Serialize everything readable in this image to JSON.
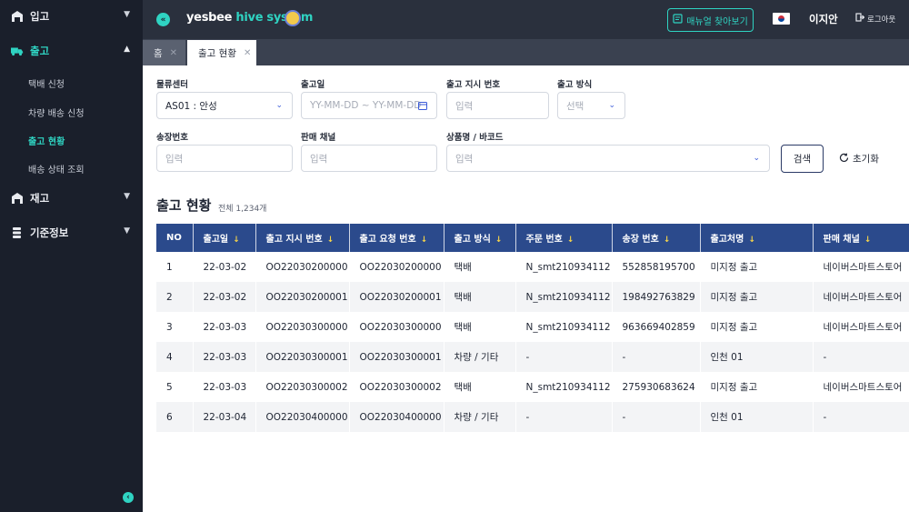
{
  "app": {
    "brand_part1": "yesbee",
    "brand_part2": "hive system",
    "accent_color": "#2fd3c2",
    "header_color": "#2b4a8c"
  },
  "sidebar": {
    "groups": [
      {
        "label": "입고",
        "icon": "warehouse-icon",
        "expanded": false
      },
      {
        "label": "출고",
        "icon": "truck-icon",
        "expanded": true
      },
      {
        "label": "재고",
        "icon": "warehouse-icon",
        "expanded": false
      },
      {
        "label": "기준정보",
        "icon": "database-icon",
        "expanded": false
      }
    ],
    "sub_items": [
      {
        "label": "택배 신청"
      },
      {
        "label": "차량 배송 신청"
      },
      {
        "label": "출고 현황"
      },
      {
        "label": "배송 상태 조회"
      }
    ]
  },
  "topbar": {
    "manual_button": "매뉴얼 찾아보기",
    "user_name": "이지안",
    "logout": "로그아웃",
    "flag": "korea-flag-icon"
  },
  "tabs": [
    {
      "label": "홈"
    },
    {
      "label": "출고 현황"
    }
  ],
  "filters": {
    "center_label": "물류센터",
    "center_value": "AS01 : 안성",
    "date_label": "출고일",
    "date_placeholder": "YY-MM-DD ~ YY-MM-DD",
    "instruction_label": "출고 지시 번호",
    "instruction_placeholder": "입력",
    "method_label": "출고 방식",
    "method_placeholder": "선택",
    "invoice_label": "송장번호",
    "invoice_placeholder": "입력",
    "channel_label": "판매 채널",
    "channel_placeholder": "입력",
    "product_label": "상품명 / 바코드",
    "product_placeholder": "입력",
    "search_button": "검색",
    "reset_button": "초기화"
  },
  "section": {
    "title": "출고 현황",
    "count": "전체 1,234개"
  },
  "table": {
    "columns": [
      "NO",
      "출고일",
      "출고 지시 번호",
      "출고 요청 번호",
      "출고 방식",
      "주문 번호",
      "송장 번호",
      "출고처명",
      "판매 채널"
    ],
    "sortable": [
      false,
      true,
      true,
      true,
      true,
      true,
      true,
      true,
      true
    ],
    "sort_arrow": "↓",
    "rows": [
      [
        "1",
        "22-03-02",
        "OO22030200000",
        "OO22030200000",
        "택배",
        "N_smt210934112",
        "552858195700",
        "미지정 출고",
        "네이버스마트스토어"
      ],
      [
        "2",
        "22-03-02",
        "OO22030200001",
        "OO22030200001",
        "택배",
        "N_smt210934112",
        "198492763829",
        "미지정 출고",
        "네이버스마트스토어"
      ],
      [
        "3",
        "22-03-03",
        "OO22030300000",
        "OO22030300000",
        "택배",
        "N_smt210934112",
        "963669402859",
        "미지정 출고",
        "네이버스마트스토어"
      ],
      [
        "4",
        "22-03-03",
        "OO22030300001",
        "OO22030300001",
        "차량 / 기타",
        "-",
        "-",
        "인천 01",
        "-"
      ],
      [
        "5",
        "22-03-03",
        "OO22030300002",
        "OO22030300002",
        "택배",
        "N_smt210934112",
        "275930683624",
        "미지정 출고",
        "네이버스마트스토어"
      ],
      [
        "6",
        "22-03-04",
        "OO22030400000",
        "OO22030400000",
        "차량 / 기타",
        "-",
        "-",
        "인천 01",
        "-"
      ]
    ]
  }
}
